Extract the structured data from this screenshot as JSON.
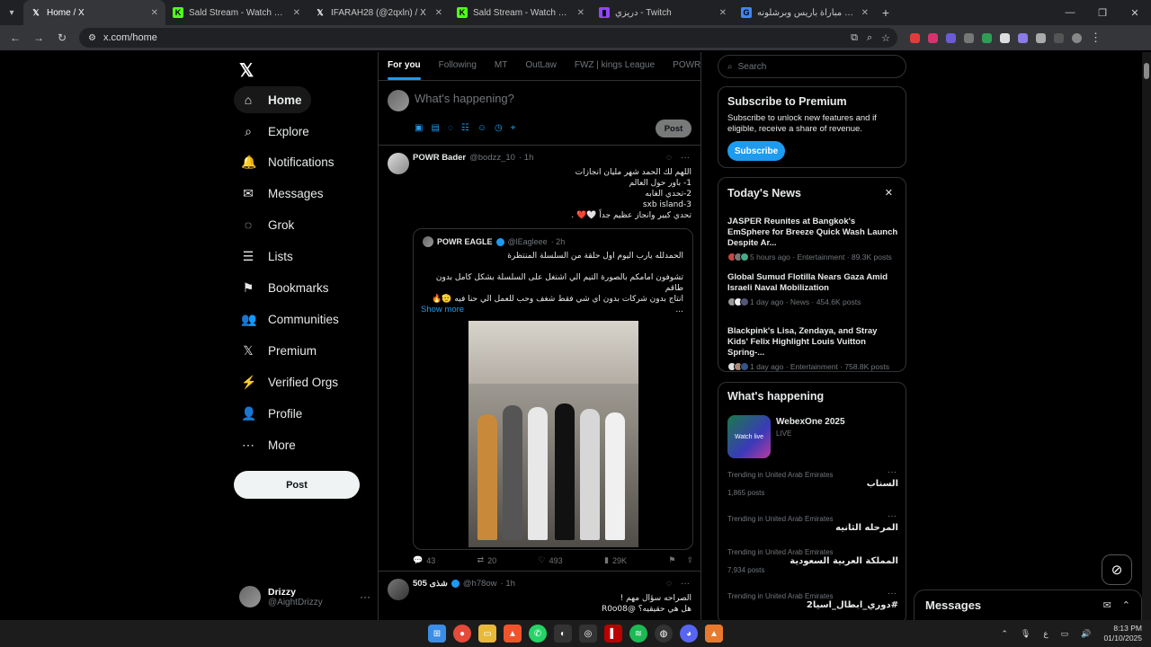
{
  "browser": {
    "tabs": [
      {
        "label": "Home / X",
        "icon": "x-logo-icon",
        "color": "#ffffff",
        "active": true
      },
      {
        "label": "Sald Stream - Watch Live on Kic",
        "icon": "kick-icon",
        "color": "#53fc18",
        "active": false
      },
      {
        "label": "IFARAH28 (@2qxln) / X",
        "icon": "x-logo-icon",
        "color": "#ffffff",
        "active": false
      },
      {
        "label": "Sald Stream - Watch Live on Kic",
        "icon": "kick-icon",
        "color": "#53fc18",
        "active": false
      },
      {
        "label": "دريزي - Twitch",
        "icon": "twitch-icon",
        "color": "#9146ff",
        "active": false
      },
      {
        "label": "مباراة باريس وبرشلونه - Search",
        "icon": "google-icon",
        "color": "#4285f4",
        "active": false
      }
    ],
    "url": "x.com/home"
  },
  "leftnav": {
    "logo": "𝕏",
    "items": [
      {
        "label": "Home",
        "icon": "⌂"
      },
      {
        "label": "Explore",
        "icon": "⌕"
      },
      {
        "label": "Notifications",
        "icon": "🔔"
      },
      {
        "label": "Messages",
        "icon": "✉"
      },
      {
        "label": "Grok",
        "icon": "◌"
      },
      {
        "label": "Lists",
        "icon": "☰"
      },
      {
        "label": "Bookmarks",
        "icon": "⚑"
      },
      {
        "label": "Communities",
        "icon": "👥"
      },
      {
        "label": "Premium",
        "icon": "𝕏"
      },
      {
        "label": "Verified Orgs",
        "icon": "⚡"
      },
      {
        "label": "Profile",
        "icon": "👤"
      },
      {
        "label": "More",
        "icon": "⋯"
      }
    ],
    "post_label": "Post",
    "account": {
      "name": "Drizzy",
      "handle": "@AightDrizzy"
    }
  },
  "timeline": {
    "tabs": [
      "For you",
      "Following",
      "MT",
      "OutLaw",
      "FWZ | kings League",
      "POWR | بور"
    ],
    "compose_placeholder": "What's happening?",
    "compose_post": "Post",
    "tweets": [
      {
        "name": "POWR Bader",
        "handle": "@bodzz_10",
        "time": "· 1h",
        "lines": [
          "اللهم لك الحمد شهر مليان انجازات",
          "1- باور حول العالم",
          "2-تحدي الغابه",
          "sxb island-3",
          "تحدي كبير وانجاز عظيم جداً 🤍❤️ ."
        ],
        "quote": {
          "name": "POWR EAGLE",
          "handle": "@lEagleee",
          "time": "· 2h",
          "lines": [
            "الحمدلله يارب اليوم اول حلقة من السلسلة المنتظرة",
            "",
            "تشوفون امامكم بالصورة التيم الي اشتغل على السلسلة بشكل كامل بدون طاقم",
            "انتاج بدون شركات بدون اي شي فقط شغف وحب للعمل الي حنا فيه 🫡🔥",
            "..."
          ],
          "show_more": "Show more"
        },
        "stats": {
          "replies": "43",
          "reposts": "20",
          "likes": "493",
          "views": "29K"
        }
      },
      {
        "name": "شذى 505",
        "handle": "@h78ow",
        "time": "· 1h",
        "lines": [
          "الصراحه سؤال مهم !",
          "هل هي حقيقيه؟ @R0o08"
        ]
      }
    ]
  },
  "sidebar": {
    "search_placeholder": "Search",
    "premium": {
      "title": "Subscribe to Premium",
      "text": "Subscribe to unlock new features and if eligible, receive a share of revenue.",
      "button": "Subscribe"
    },
    "news": {
      "title": "Today's News",
      "items": [
        {
          "title": "JASPER Reunites at Bangkok's EmSphere for Breeze Quick Wash Launch Despite Ar...",
          "meta": "5 hours ago · Entertainment · 89.3K posts"
        },
        {
          "title": "Global Sumud Flotilla Nears Gaza Amid Israeli Naval Mobilization",
          "meta": "1 day ago · News · 454.6K posts"
        },
        {
          "title": "Blackpink's Lisa, Zendaya, and Stray Kids' Felix Highlight Louis Vuitton Spring-...",
          "meta": "1 day ago · Entertainment · 758.8K posts"
        }
      ]
    },
    "happening": {
      "title": "What's happening",
      "event": {
        "name": "WebexOne 2025",
        "status": "LIVE",
        "thumb_text": "Watch live"
      },
      "trends": [
        {
          "context": "Trending in United Arab Emirates",
          "name": "السناب",
          "count": "1,865 posts"
        },
        {
          "context": "Trending in United Arab Emirates",
          "name": "المرحله الثانيه",
          "count": ""
        },
        {
          "context": "Trending in United Arab Emirates",
          "name": "المملكة العربية السعودية",
          "count": "7,934 posts"
        },
        {
          "context": "Trending in United Arab Emirates",
          "name": "#دوري_ابطال_اسيا2",
          "count": ""
        }
      ]
    }
  },
  "messages_dock": {
    "title": "Messages"
  },
  "taskbar": {
    "time": "8:13 PM",
    "date": "01/10/2025",
    "lang": "ع"
  }
}
